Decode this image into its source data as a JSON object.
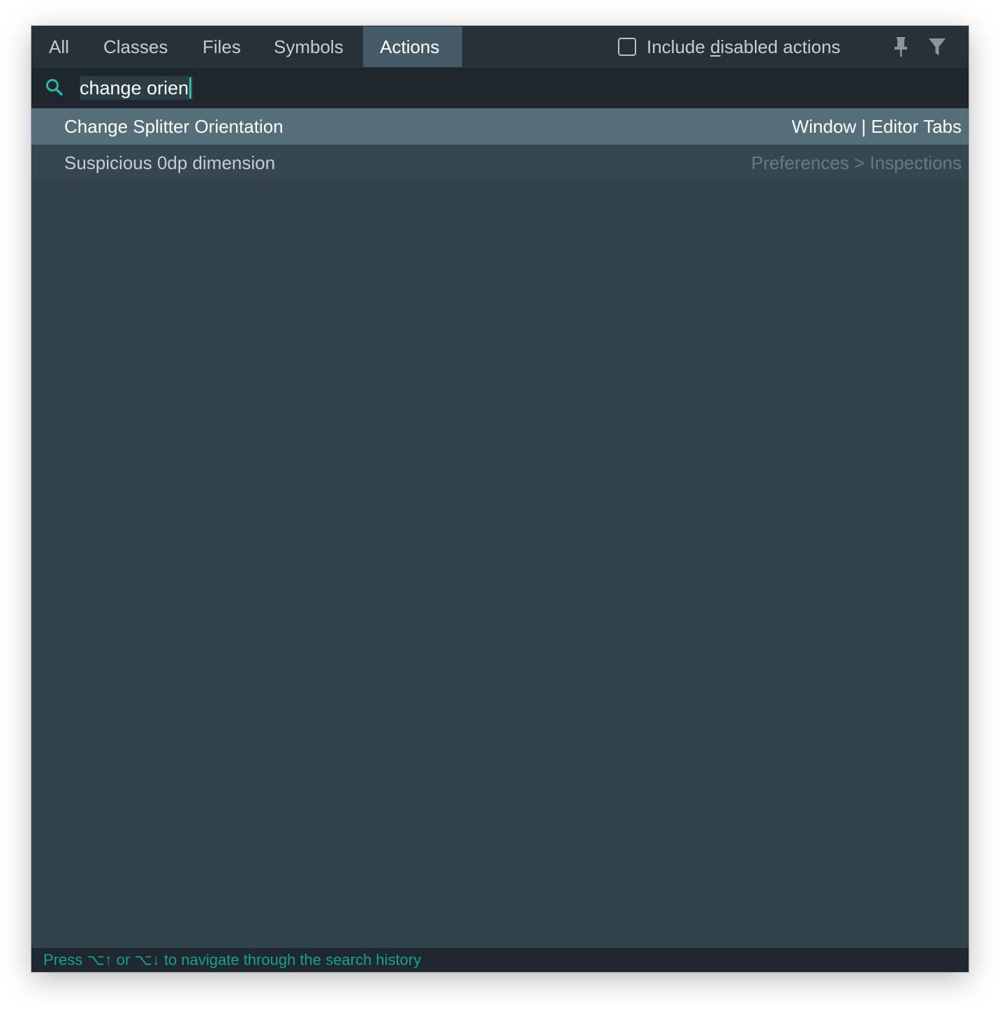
{
  "tabs": [
    {
      "label": "All"
    },
    {
      "label": "Classes"
    },
    {
      "label": "Files"
    },
    {
      "label": "Symbols"
    },
    {
      "label": "Actions"
    }
  ],
  "active_tab": "Actions",
  "options": {
    "include_disabled_label_pre": "Include ",
    "include_disabled_label_mnemonic": "d",
    "include_disabled_label_post": "isabled actions",
    "include_disabled_checked": false,
    "pin_icon": "pin-icon",
    "filter_icon": "filter-icon"
  },
  "search": {
    "icon": "search-icon",
    "value": "change orien"
  },
  "results": [
    {
      "name": "Change Splitter Orientation",
      "path": "Window | Editor Tabs",
      "selected": true
    },
    {
      "name": "Suspicious 0dp dimension",
      "path": "Preferences > Inspections",
      "selected": false
    }
  ],
  "footer": {
    "hint": "Press ⌥↑ or ⌥↓ to navigate through the search history"
  },
  "colors": {
    "background": "#32424b",
    "tabbar": "#263238",
    "active_tab": "#455a66",
    "search_row": "#1e272d",
    "selected_row": "#546e7a",
    "accent": "#1fb5a5"
  }
}
